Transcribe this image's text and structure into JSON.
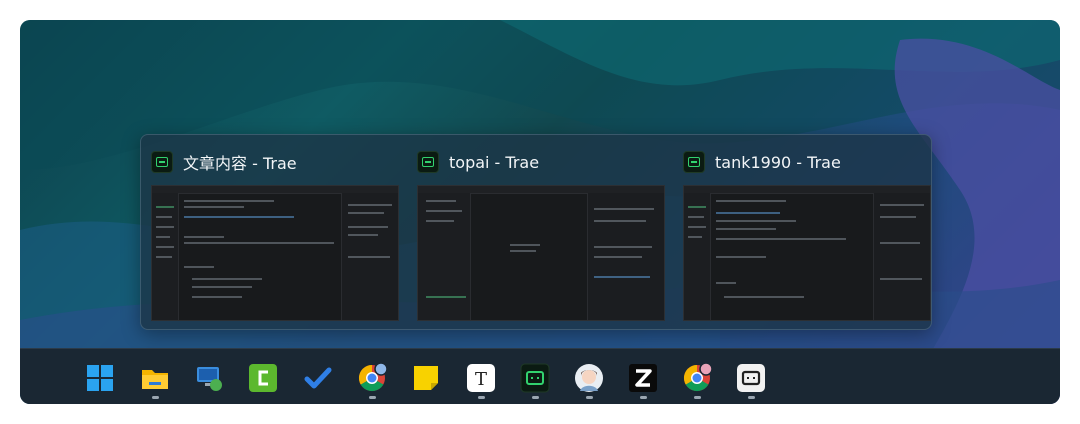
{
  "switcher": {
    "windows": [
      {
        "title": "文章内容 - Trae",
        "app_icon": "trae-icon"
      },
      {
        "title": "topai - Trae",
        "app_icon": "trae-icon"
      },
      {
        "title": "tank1990 - Trae",
        "app_icon": "trae-icon"
      }
    ]
  },
  "taskbar": {
    "apps": [
      {
        "name": "start-menu",
        "icon": "windows-logo-icon",
        "running": false
      },
      {
        "name": "file-explorer",
        "icon": "folder-icon",
        "running": true
      },
      {
        "name": "remote-desktop",
        "icon": "remote-desktop-icon",
        "running": false
      },
      {
        "name": "camtasia",
        "icon": "camtasia-icon",
        "running": false
      },
      {
        "name": "todo",
        "icon": "checkmark-icon",
        "running": false
      },
      {
        "name": "chrome-profile-1",
        "icon": "chrome-icon",
        "running": true
      },
      {
        "name": "sticky-notes",
        "icon": "sticky-note-icon",
        "running": false
      },
      {
        "name": "typora",
        "icon": "typora-t-icon",
        "running": true
      },
      {
        "name": "trae",
        "icon": "trae-icon",
        "running": true
      },
      {
        "name": "avatar-app",
        "icon": "avatar-icon",
        "running": true
      },
      {
        "name": "zed",
        "icon": "z-logo-icon",
        "running": true
      },
      {
        "name": "chrome-profile-2",
        "icon": "chrome-icon",
        "running": true
      },
      {
        "name": "trae-alt",
        "icon": "trae-alt-icon",
        "running": true
      }
    ]
  }
}
